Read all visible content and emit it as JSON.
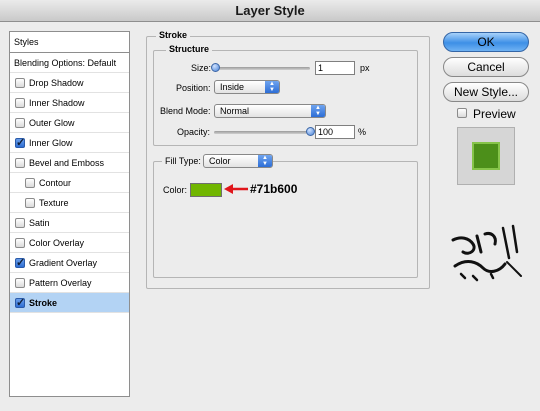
{
  "window": {
    "title": "Layer Style"
  },
  "sidebar": {
    "header": "Styles",
    "blending_options": "Blending Options: Default",
    "items": [
      {
        "label": "Drop Shadow",
        "checked": false,
        "indent": false,
        "selected": false
      },
      {
        "label": "Inner Shadow",
        "checked": false,
        "indent": false,
        "selected": false
      },
      {
        "label": "Outer Glow",
        "checked": false,
        "indent": false,
        "selected": false
      },
      {
        "label": "Inner Glow",
        "checked": true,
        "indent": false,
        "selected": false
      },
      {
        "label": "Bevel and Emboss",
        "checked": false,
        "indent": false,
        "selected": false
      },
      {
        "label": "Contour",
        "checked": false,
        "indent": true,
        "selected": false
      },
      {
        "label": "Texture",
        "checked": false,
        "indent": true,
        "selected": false
      },
      {
        "label": "Satin",
        "checked": false,
        "indent": false,
        "selected": false
      },
      {
        "label": "Color Overlay",
        "checked": false,
        "indent": false,
        "selected": false
      },
      {
        "label": "Gradient Overlay",
        "checked": true,
        "indent": false,
        "selected": false
      },
      {
        "label": "Pattern Overlay",
        "checked": false,
        "indent": false,
        "selected": false
      },
      {
        "label": "Stroke",
        "checked": true,
        "indent": false,
        "selected": true
      }
    ]
  },
  "stroke": {
    "title": "Stroke",
    "structure_title": "Structure",
    "size_label": "Size:",
    "size_value": "1",
    "size_unit": "px",
    "size_level": 0.01,
    "position_label": "Position:",
    "position_value": "Inside",
    "blend_mode_label": "Blend Mode:",
    "blend_mode_value": "Normal",
    "opacity_label": "Opacity:",
    "opacity_value": "100",
    "opacity_unit": "%",
    "opacity_level": 1.0,
    "fill_type_label": "Fill Type:",
    "fill_type_value": "Color",
    "color_label": "Color:",
    "color_hex": "#71b600",
    "annotation_text": "#71b600"
  },
  "buttons": {
    "ok": "OK",
    "cancel": "Cancel",
    "new_style": "New Style..."
  },
  "preview": {
    "label": "Preview",
    "checked": false
  },
  "colors": {
    "swatch": "#71b600",
    "selection": "#b3d3f4",
    "annotation_arrow": "#e0161b",
    "preview_fill": "#4c8f1a",
    "preview_border": "#86c44a"
  }
}
